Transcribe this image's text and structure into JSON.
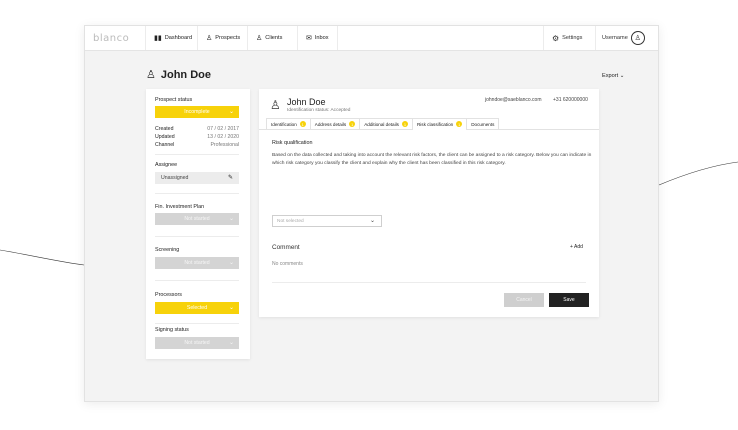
{
  "nav": {
    "logo": "blanco",
    "items": [
      {
        "label": "Dashboard",
        "icon": "bar-chart-icon"
      },
      {
        "label": "Prospects",
        "icon": "user-icon"
      },
      {
        "label": "Clients",
        "icon": "users-icon"
      },
      {
        "label": "Inbox",
        "icon": "mail-icon"
      }
    ],
    "settings_label": "Settings",
    "username": "Username"
  },
  "page": {
    "title": "John Doe",
    "export_label": "Export"
  },
  "sidebar": {
    "prospect_status_label": "Prospect status",
    "prospect_status_value": "Incomplete",
    "dates": [
      {
        "key": "Created",
        "value": "07 / 02 / 2017"
      },
      {
        "key": "Updated",
        "value": "13 / 02 / 2020"
      },
      {
        "key": "Channel",
        "value": "Professional"
      }
    ],
    "assignee_label": "Assignee",
    "assignee_value": "Unassigned",
    "fin_plan_label": "Fin. Investment Plan",
    "fin_plan_value": "Not started",
    "screening_label": "Screening",
    "screening_value": "Not started",
    "processors_label": "Processors",
    "processors_value": "Selected",
    "signing_label": "Signing status",
    "signing_value": "Not started"
  },
  "client": {
    "name": "John Doe",
    "status": "Identification status: Accepted",
    "email": "johndoe@saeblanco.com",
    "phone": "+31 620000000"
  },
  "tabs": [
    {
      "label": "Identification",
      "badge": "1"
    },
    {
      "label": "Address details",
      "badge": "1"
    },
    {
      "label": "Additional details",
      "badge": "1"
    },
    {
      "label": "Risk classification",
      "badge": "1"
    },
    {
      "label": "Documents",
      "badge": ""
    }
  ],
  "risk": {
    "title": "Risk qualification",
    "description": "Based on the data collected and taking into account the relevant risk factors, the client can be assigned to a risk category. Below you can indicate in which risk category you classify the client and explain why the client has been classified in this risk category.",
    "dropdown_placeholder": "Not selected"
  },
  "comments": {
    "title": "Comment",
    "add_label": "+ Add",
    "empty_text": "No comments"
  },
  "actions": {
    "cancel_label": "Cancel",
    "save_label": "Save"
  },
  "colors": {
    "accent": "#f7d20a",
    "disabled": "#d4d4d4",
    "primary_button": "#222222"
  }
}
